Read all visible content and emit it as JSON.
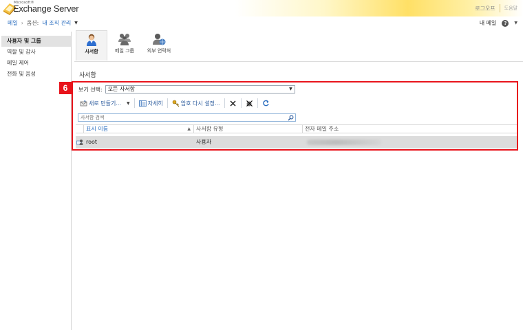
{
  "header": {
    "brand_small": "Microsoft®",
    "brand_name": "Exchange Server",
    "logout": "로그오프",
    "help": "도움말",
    "colors": {
      "accent_yellow": "#ffe066",
      "link_blue": "#2a6dbf",
      "highlight_red": "#e8131b"
    }
  },
  "nav": {
    "mail_link": "메일",
    "options_label": "옵션:",
    "scope": "내 조직 관리",
    "my_mail": "내 메일",
    "help_icon": "?"
  },
  "sidebar": {
    "items": [
      {
        "label": "사용자 및 그룹",
        "selected": true
      },
      {
        "label": "역할 및 감사",
        "selected": false
      },
      {
        "label": "메일 제어",
        "selected": false
      },
      {
        "label": "전화 및 음성",
        "selected": false
      }
    ]
  },
  "tabs": [
    {
      "label": "사서함",
      "icon": "user-icon",
      "active": true
    },
    {
      "label": "메일 그룹",
      "icon": "group-icon",
      "active": false
    },
    {
      "label": "외부 연락처",
      "icon": "contact-icon",
      "active": false
    }
  ],
  "section": {
    "title": "사서함"
  },
  "annotation": {
    "step": "6"
  },
  "view": {
    "label": "보기 선택:",
    "selected": "모든 사서함"
  },
  "toolbar": {
    "new_label": "새로 만들기...",
    "details_label": "자세히",
    "reset_password_label": "암호 다시 설정...",
    "delete_icon": "close-icon",
    "disable_icon": "disable-icon",
    "refresh_icon": "refresh-icon"
  },
  "search": {
    "placeholder": "사서함 검색"
  },
  "grid": {
    "columns": [
      "표시 이름",
      "사서함 유형",
      "전자 메일 주소"
    ],
    "rows": [
      {
        "display_name": "root",
        "mailbox_type": "사용자",
        "email": ""
      }
    ]
  }
}
